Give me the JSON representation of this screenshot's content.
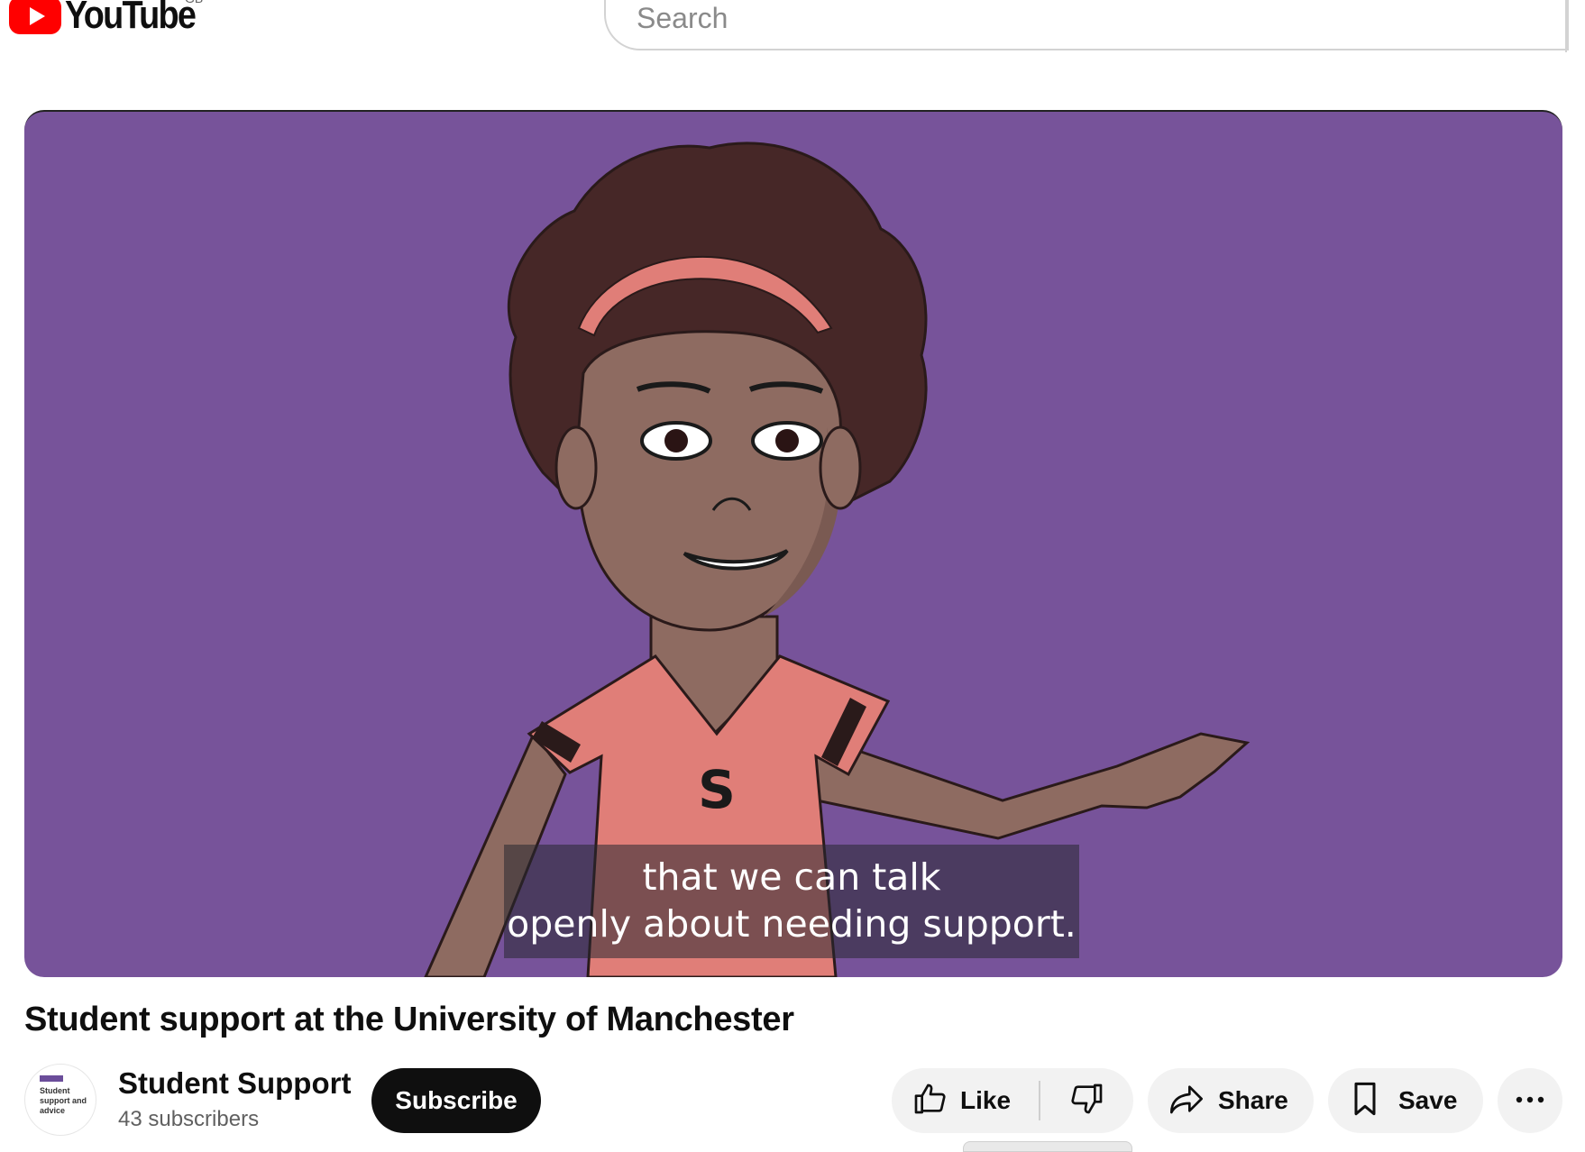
{
  "header": {
    "logo_text": "YouTube",
    "region": "GB",
    "search_placeholder": "Search"
  },
  "player": {
    "caption_line1": "that we can talk",
    "caption_line2": "openly about needing support.",
    "background_color": "#77539a"
  },
  "video": {
    "title": "Student support at the University of Manchester"
  },
  "channel": {
    "name": "Student Support",
    "subscribers": "43 subscribers",
    "avatar_text": "Student support and advice"
  },
  "actions": {
    "subscribe": "Subscribe",
    "like": "Like",
    "share": "Share",
    "save": "Save"
  },
  "icons": [
    "youtube-logo-icon",
    "thumbs-up-icon",
    "thumbs-down-icon",
    "share-arrow-icon",
    "bookmark-icon",
    "more-icon"
  ]
}
